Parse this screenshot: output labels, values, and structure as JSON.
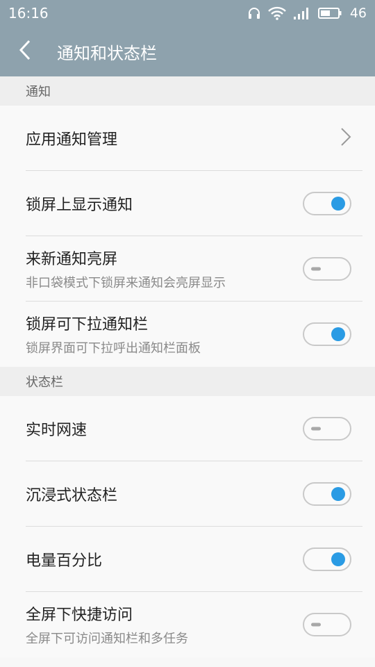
{
  "status_bar": {
    "time": "16:16",
    "battery_level": "46",
    "icons": [
      "headphones-icon",
      "wifi-icon",
      "signal-icon",
      "battery-icon"
    ]
  },
  "header": {
    "title": "通知和状态栏",
    "back_icon": "chevron-left-icon",
    "background": "#8ea2ad"
  },
  "sections": [
    {
      "title": "通知",
      "items": [
        {
          "label": "应用通知管理",
          "type": "nav"
        },
        {
          "label": "锁屏上显示通知",
          "type": "toggle",
          "on": true
        },
        {
          "label": "来新通知亮屏",
          "sub": "非口袋模式下锁屏来通知会亮屏显示",
          "type": "toggle",
          "on": false
        },
        {
          "label": "锁屏可下拉通知栏",
          "sub": "锁屏界面可下拉呼出通知栏面板",
          "type": "toggle",
          "on": true
        }
      ]
    },
    {
      "title": "状态栏",
      "items": [
        {
          "label": "实时网速",
          "type": "toggle",
          "on": false
        },
        {
          "label": "沉浸式状态栏",
          "type": "toggle",
          "on": true
        },
        {
          "label": "电量百分比",
          "type": "toggle",
          "on": true
        },
        {
          "label": "全屏下快捷访问",
          "sub": "全屏下可访问通知栏和多任务",
          "type": "toggle",
          "on": false
        }
      ]
    }
  ],
  "colors": {
    "accent": "#2a9be4",
    "toggle_off": "#a8a8a8"
  }
}
